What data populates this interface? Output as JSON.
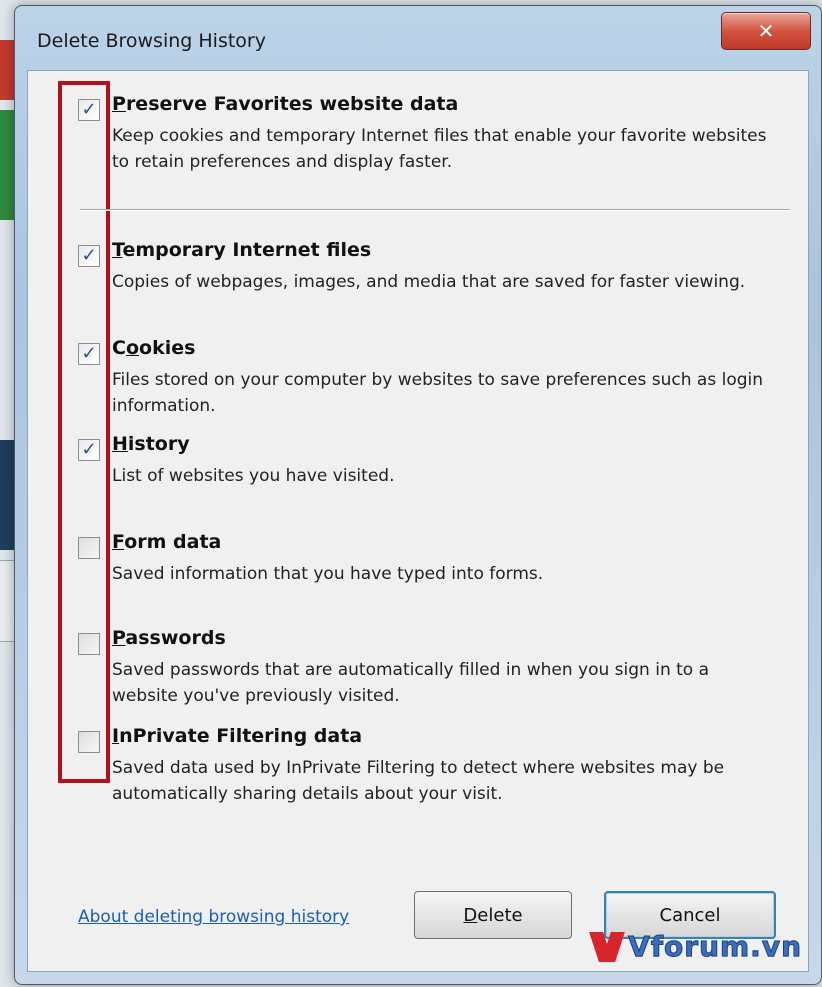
{
  "window": {
    "title": "Delete Browsing History",
    "close_glyph": "✕"
  },
  "options": [
    {
      "title_ul": "P",
      "title_rest": "reserve Favorites website data",
      "description": "Keep cookies and temporary Internet files that enable your favorite websites to retain preferences and display faster.",
      "checked": true
    },
    {
      "title_ul": "T",
      "title_rest": "emporary Internet files",
      "description": "Copies of webpages, images, and media that are saved for faster viewing.",
      "checked": true
    },
    {
      "title_pre": "C",
      "title_ul": "o",
      "title_rest": "okies",
      "description": "Files stored on your computer by websites to save preferences such as login information.",
      "checked": true
    },
    {
      "title_ul": "H",
      "title_rest": "istory",
      "description": "List of websites you have visited.",
      "checked": true
    },
    {
      "title_ul": "F",
      "title_rest": "orm data",
      "description": "Saved information that you have typed into forms.",
      "checked": false
    },
    {
      "title_ul": "P",
      "title_rest": "asswords",
      "description": "Saved passwords that are automatically filled in when you sign in to a website you've previously visited.",
      "checked": false
    },
    {
      "title_ul": "I",
      "title_rest": "nPrivate Filtering data",
      "description": "Saved data used by InPrivate Filtering to detect where websites may be automatically sharing details about your visit.",
      "checked": false
    }
  ],
  "footer": {
    "link_text": "About deleting browsing history",
    "delete_ul": "D",
    "delete_rest": "elete",
    "cancel_label": "Cancel"
  },
  "watermark": {
    "text": "Vforum.vn"
  },
  "check_glyph": "✓",
  "colors": {
    "highlight": "#b0121b",
    "link": "#1a5fb4",
    "check": "#2a4c8f"
  }
}
